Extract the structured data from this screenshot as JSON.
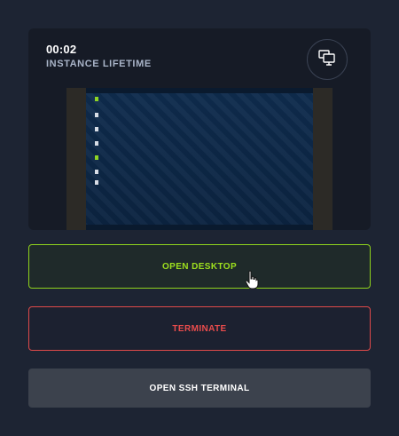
{
  "instance": {
    "timer": "00:02",
    "lifetime_label": "INSTANCE LIFETIME"
  },
  "icons": {
    "screen_toggle": "monitor-share-icon",
    "cursor": "hand-pointer-icon"
  },
  "actions": {
    "open_desktop": "OPEN DESKTOP",
    "terminate": "TERMINATE",
    "open_ssh": "OPEN SSH TERMINAL"
  },
  "colors": {
    "background": "#1d2433",
    "card": "#161b26",
    "accent_green": "#9ee01e",
    "danger_red": "#ea4c4c",
    "neutral_button": "#3c424d"
  }
}
